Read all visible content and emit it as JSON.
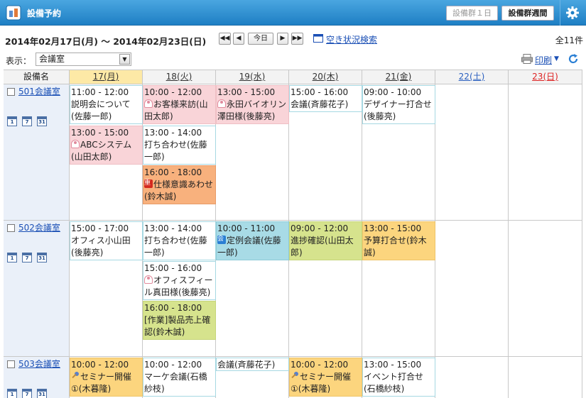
{
  "app": {
    "title": "設備予約",
    "btn_day": "設備群１日",
    "btn_week": "設備群週間"
  },
  "toolbar": {
    "date_range": "2014年02月17日(月) 〜 2014年02月23日(日)",
    "nav_first": "◀◀",
    "nav_prev": "◀",
    "nav_today": "今日",
    "nav_next": "▶",
    "nav_last": "▶▶",
    "search_label": "空き状況検索",
    "total": "全11件",
    "display_label": "表示：",
    "display_value": "会議室",
    "print_label": "印刷"
  },
  "grid": {
    "name_header": "設備名",
    "days": [
      "17(月)",
      "18(火)",
      "19(水)",
      "20(木)",
      "21(金)",
      "22(土)",
      "23(日)"
    ]
  },
  "rooms": [
    {
      "name": "501会議室",
      "cal_icons": [
        "1",
        "7",
        "31"
      ]
    },
    {
      "name": "502会議室",
      "cal_icons": [
        "1",
        "7",
        "31"
      ]
    },
    {
      "name": "503会議室",
      "cal_icons": [
        "1",
        "7",
        "31"
      ]
    }
  ],
  "events": {
    "r0": [
      {
        "time": "11:00 - 12:00",
        "title": "説明会について(佐藤一郎)"
      },
      {
        "time": "13:00 - 15:00",
        "title": "ABCシステム(山田太郎)"
      },
      {
        "time": "10:00 - 12:00",
        "title": "お客様来訪(山田太郎)"
      },
      {
        "time": "13:00 - 14:00",
        "title": "打ち合わせ(佐藤一郎)"
      },
      {
        "time": "16:00 - 18:00",
        "title": "仕様意識あわせ(鈴木誠)"
      },
      {
        "time": "13:00 - 15:00",
        "title": "永田バイオリン澤田様(後藤亮)"
      },
      {
        "time": "15:00 - 16:00",
        "title": "会議(斉藤花子)"
      },
      {
        "time": "09:00 - 10:00",
        "title": "デザイナー打合せ(後藤亮)"
      }
    ],
    "r1": [
      {
        "time": "15:00 - 17:00",
        "title": "オフィス小山田(後藤亮)"
      },
      {
        "time": "13:00 - 14:00",
        "title": "打ち合わせ(佐藤一郎)"
      },
      {
        "time": "15:00 - 16:00",
        "title": "オフィスフィール真田様(後藤亮)"
      },
      {
        "time": "16:00 - 18:00",
        "title": "[作業]製品売上確認(鈴木誠)"
      },
      {
        "time": "10:00 - 11:00",
        "title": "定例会議(佐藤一郎)"
      },
      {
        "time": "09:00 - 12:00",
        "title": "進捗確認(山田太郎)"
      },
      {
        "time": "13:00 - 15:00",
        "title": "予算打合せ(鈴木誠)"
      }
    ],
    "r2": [
      {
        "time": "10:00 - 12:00",
        "title": "セミナー開催①(木暮隆)"
      },
      {
        "time": "10:00 - 12:00",
        "title": "マーケ会議(石橋紗枝)"
      },
      {
        "time": "",
        "title": "会議(斉藤花子)"
      },
      {
        "time": "10:00 - 12:00",
        "title": "セミナー開催①(木暮隆)"
      },
      {
        "time": "13:00 - 15:00",
        "title": "イベント打合せ(石橋紗枝)"
      }
    ]
  }
}
